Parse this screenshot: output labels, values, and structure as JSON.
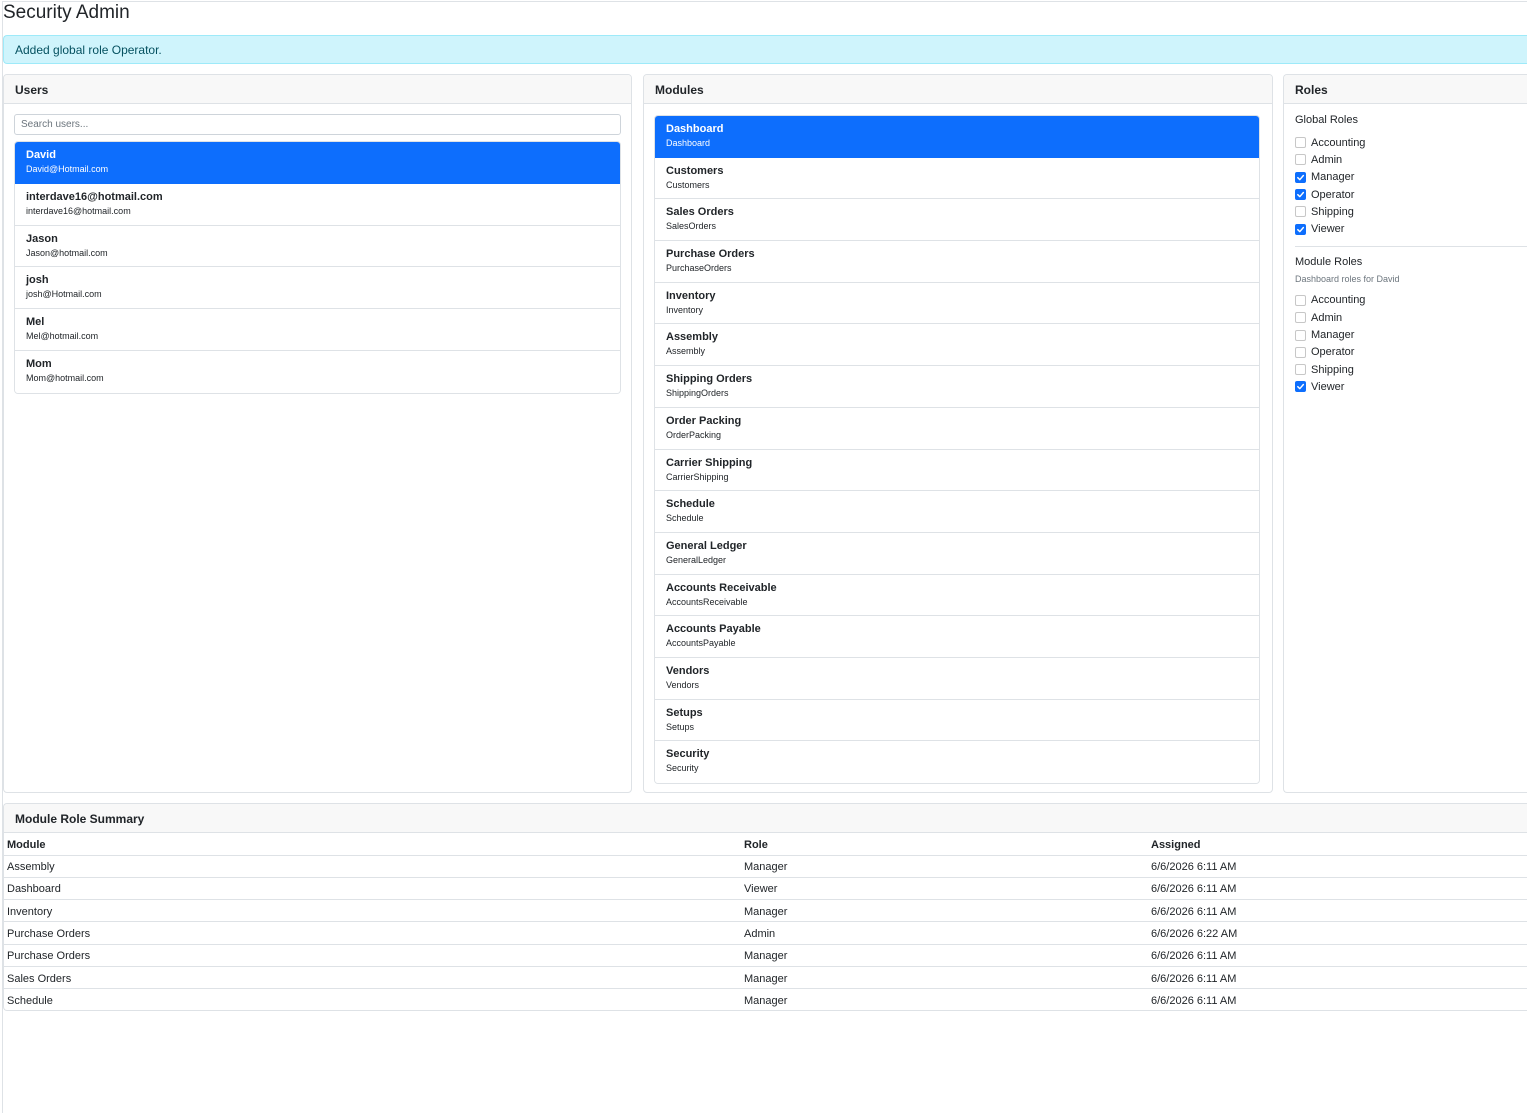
{
  "page_title": "Security Admin",
  "alert": {
    "message": "Added global role Operator."
  },
  "users": {
    "header": "Users",
    "search_placeholder": "Search users...",
    "items": [
      {
        "name": "David",
        "email": "David@Hotmail.com",
        "active": true
      },
      {
        "name": "interdave16@hotmail.com",
        "email": "interdave16@hotmail.com",
        "active": false
      },
      {
        "name": "Jason",
        "email": "Jason@hotmail.com",
        "active": false
      },
      {
        "name": "josh",
        "email": "josh@Hotmail.com",
        "active": false
      },
      {
        "name": "Mel",
        "email": "Mel@hotmail.com",
        "active": false
      },
      {
        "name": "Mom",
        "email": "Mom@hotmail.com",
        "active": false
      }
    ]
  },
  "modules": {
    "header": "Modules",
    "items": [
      {
        "name": "Dashboard",
        "key": "Dashboard",
        "active": true
      },
      {
        "name": "Customers",
        "key": "Customers",
        "active": false
      },
      {
        "name": "Sales Orders",
        "key": "SalesOrders",
        "active": false
      },
      {
        "name": "Purchase Orders",
        "key": "PurchaseOrders",
        "active": false
      },
      {
        "name": "Inventory",
        "key": "Inventory",
        "active": false
      },
      {
        "name": "Assembly",
        "key": "Assembly",
        "active": false
      },
      {
        "name": "Shipping Orders",
        "key": "ShippingOrders",
        "active": false
      },
      {
        "name": "Order Packing",
        "key": "OrderPacking",
        "active": false
      },
      {
        "name": "Carrier Shipping",
        "key": "CarrierShipping",
        "active": false
      },
      {
        "name": "Schedule",
        "key": "Schedule",
        "active": false
      },
      {
        "name": "General Ledger",
        "key": "GeneralLedger",
        "active": false
      },
      {
        "name": "Accounts Receivable",
        "key": "AccountsReceivable",
        "active": false
      },
      {
        "name": "Accounts Payable",
        "key": "AccountsPayable",
        "active": false
      },
      {
        "name": "Vendors",
        "key": "Vendors",
        "active": false
      },
      {
        "name": "Setups",
        "key": "Setups",
        "active": false
      },
      {
        "name": "Security",
        "key": "Security",
        "active": false
      }
    ]
  },
  "roles": {
    "header": "Roles",
    "global_title": "Global Roles",
    "global_roles": [
      {
        "label": "Accounting",
        "checked": false
      },
      {
        "label": "Admin",
        "checked": false
      },
      {
        "label": "Manager",
        "checked": true
      },
      {
        "label": "Operator",
        "checked": true
      },
      {
        "label": "Shipping",
        "checked": false
      },
      {
        "label": "Viewer",
        "checked": true
      }
    ],
    "module_title": "Module Roles",
    "module_hint": "Dashboard roles for David",
    "module_roles": [
      {
        "label": "Accounting",
        "checked": false
      },
      {
        "label": "Admin",
        "checked": false
      },
      {
        "label": "Manager",
        "checked": false
      },
      {
        "label": "Operator",
        "checked": false
      },
      {
        "label": "Shipping",
        "checked": false
      },
      {
        "label": "Viewer",
        "checked": true
      }
    ]
  },
  "summary": {
    "header": "Module Role Summary",
    "columns": [
      "Module",
      "Role",
      "Assigned"
    ],
    "rows": [
      [
        "Assembly",
        "Manager",
        "6/6/2026 6:11 AM"
      ],
      [
        "Dashboard",
        "Viewer",
        "6/6/2026 6:11 AM"
      ],
      [
        "Inventory",
        "Manager",
        "6/6/2026 6:11 AM"
      ],
      [
        "Purchase Orders",
        "Admin",
        "6/6/2026 6:22 AM"
      ],
      [
        "Purchase Orders",
        "Manager",
        "6/6/2026 6:11 AM"
      ],
      [
        "Sales Orders",
        "Manager",
        "6/6/2026 6:11 AM"
      ],
      [
        "Schedule",
        "Manager",
        "6/6/2026 6:11 AM"
      ]
    ]
  },
  "colors": {
    "accent": "#0d6efd",
    "alert_bg": "#cff4fc",
    "alert_text": "#055160",
    "border": "#dee2e6"
  },
  "icons": {
    "checkbox_checked": "checkmark-icon"
  }
}
